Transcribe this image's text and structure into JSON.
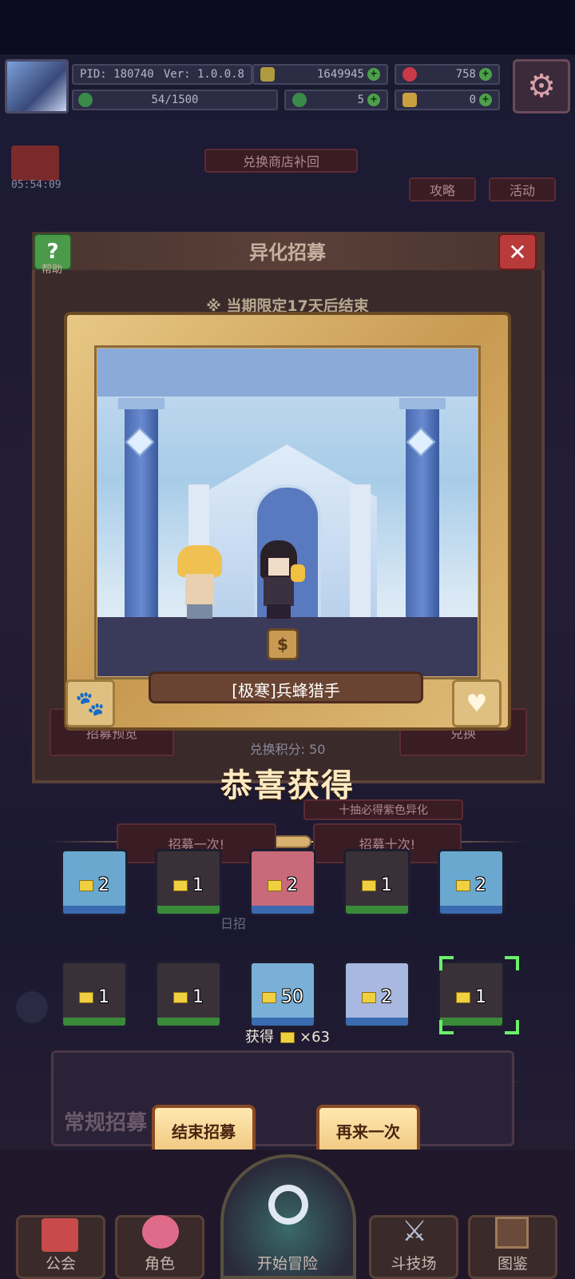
{
  "topbar": {
    "pid": "PID: 180740",
    "version": "Ver: 1.0.0.8",
    "gold": "1649945",
    "gems": "758",
    "stamina": "54/1500",
    "clover": "5",
    "tickets": "0"
  },
  "background": {
    "timer": "05:54:09",
    "event_banner": "兑换商店补回",
    "guide_btn": "攻略",
    "activity_btn": "活动",
    "preview_btn": "招募预览",
    "exchange_btn": "兑换",
    "pull_one": "招募一次!",
    "pull_ten": "招募十次!",
    "ten_hint": "十抽必得紫色异化",
    "daily_hint": "日招",
    "normal_recruit": "常规招募"
  },
  "dialog": {
    "title": "异化招募",
    "help_label": "帮助",
    "notice": "※ 当期限定17天后结束",
    "exchange_points": "兑换积分: 50"
  },
  "card": {
    "name": "[极寒]兵蜂猎手",
    "badge_symbol": "$"
  },
  "result": {
    "congrats": "恭喜获得",
    "slots_row1": [
      {
        "count": "2",
        "portrait": "#6aa8d0",
        "rarity": "#3a6ab0"
      },
      {
        "count": "1",
        "portrait": "#3a3038",
        "rarity": "#3a8a3a"
      },
      {
        "count": "2",
        "portrait": "#c86a7a",
        "rarity": "#3a6ab0"
      },
      {
        "count": "1",
        "portrait": "#3a3038",
        "rarity": "#3a8a3a"
      },
      {
        "count": "2",
        "portrait": "#6aa8d0",
        "rarity": "#3a6ab0"
      }
    ],
    "slots_row2": [
      {
        "count": "1",
        "portrait": "#3a3038",
        "rarity": "#3a8a3a"
      },
      {
        "count": "1",
        "portrait": "#3a3038",
        "rarity": "#3a8a3a"
      },
      {
        "count": "50",
        "portrait": "#7ab0d8",
        "rarity": "#3a6ab0"
      },
      {
        "count": "2",
        "portrait": "#a8b8e0",
        "rarity": "#3a6ab0"
      },
      {
        "count": "1",
        "portrait": "#3a3038",
        "rarity": "#3a8a3a"
      }
    ],
    "obtain_label": "获得",
    "obtain_count": "×63",
    "end_btn": "结束招募",
    "again_btn": "再来一次"
  },
  "nav": {
    "guild": "公会",
    "role": "角色",
    "start": "开始冒险",
    "arena": "斗技场",
    "codex": "图鉴"
  },
  "colors": {
    "accent_gold": "#e8c886",
    "frame_dark": "#6a4a24",
    "selected_green": "#6af06a"
  }
}
